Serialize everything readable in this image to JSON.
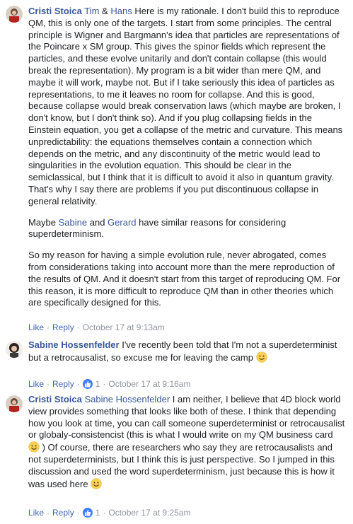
{
  "comments": [
    {
      "author": "Cristi Stoica",
      "mentions": [
        "Tim",
        "Hans"
      ],
      "mention_joiner": " & ",
      "paragraphs": [
        "Here is my rationale. I don't build this to reproduce QM, this is only one of the targets. I start from some principles. The central principle is Wigner and Bargmann's idea that particles are representations of the Poincare x SM group. This gives the spinor fields which represent the particles, and these evolve unitarily and don't contain collapse (this would break the representation). My program is a bit wider than mere QM, and maybe it will work, maybe not. But if I take seriously this idea of particles as representations, to me it leaves no room for collapse. And this is good, because collapse would break conservation laws (which maybe are broken, I don't know, but I don't think so). And if you plug collapsing fields in the Einstein equation, you get a collapse of the metric and curvature. This means unpredictability: the equations themselves contain a connection which depends on the metric, and any discontinuity of the metric would lead to singularities in the evolution equation. This should be clear in the semiclassical, but I think that it is difficult to avoid it also in quantum gravity. That's why I say there are problems if you put discontinuous collapse in general relativity."
      ],
      "p2_before": "Maybe ",
      "p2_m1": "Sabine",
      "p2_mid": " and ",
      "p2_m2": "Gerard",
      "p2_after": " have similar reasons for considering superdeterminism.",
      "p3": "So my reason for having a simple evolution rule, never abrogated, comes from considerations taking into account more than the mere reproduction of the results of QM. And it doesn't start from this target of reproducing QM. For this reason, it is more difficult to reproduce QM than in other theories which are specifically designed for this.",
      "like_label": "Like",
      "reply_label": "Reply",
      "timestamp": "October 17 at 9:13am"
    },
    {
      "author": "Sabine Hossenfelder",
      "text": "I've recently been told that I'm not a superdeterminist but a retrocausalist, so excuse me for leaving the camp",
      "emoji": "smiley-icon",
      "like_label": "Like",
      "reply_label": "Reply",
      "reaction_count": "1",
      "timestamp": "October 17 at 9:16am"
    },
    {
      "author": "Cristi Stoica",
      "mention": "Sabine Hossenfelder",
      "text_a": " I am neither, I believe that 4D block world view provides something that looks like both of these. I think that depending how you look at time, you can call someone superdeterminist or retrocausalist or globaly-consistencist (this is what I would write on my QM business card ",
      "text_b": " ) Of course, there are researchers who say they are retrocausalists and not superdeterminists, but I think this is just perspective. So I jumped in this discussion and used the word superdeterminism, just because this is how it was used here ",
      "like_label": "Like",
      "reply_label": "Reply",
      "reaction_count": "1",
      "timestamp": "October 17 at 9:25am"
    }
  ],
  "colors": {
    "link": "#385898",
    "action": "#4267b2",
    "muted": "#90949c",
    "like_badge": "#4080ff"
  }
}
